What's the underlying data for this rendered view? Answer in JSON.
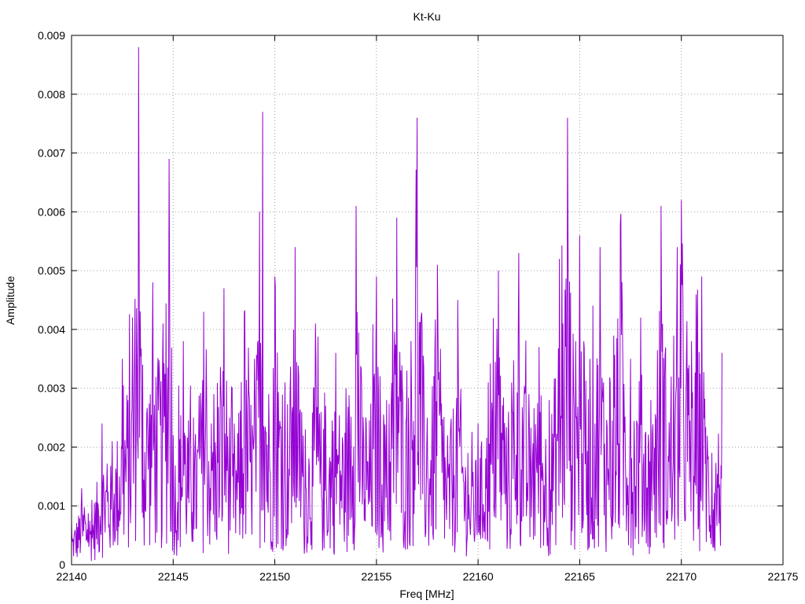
{
  "chart_data": {
    "type": "line",
    "title": "Kt-Ku",
    "xlabel": "Freq [MHz]",
    "ylabel": "Amplitude",
    "xlim": [
      22140,
      22175
    ],
    "ylim": [
      0,
      0.009
    ],
    "xticks": [
      "22140",
      "22145",
      "22150",
      "22155",
      "22160",
      "22165",
      "22170",
      "22175"
    ],
    "yticks": [
      "0",
      "0.001",
      "0.002",
      "0.003",
      "0.004",
      "0.005",
      "0.006",
      "0.007",
      "0.008",
      "0.009"
    ],
    "grid": true,
    "series": [
      {
        "color": "#9400d3",
        "x": [
          22140.0,
          22140.5,
          22141.0,
          22141.5,
          22142.0,
          22142.5,
          22143.0,
          22143.3,
          22143.5,
          22144.0,
          22144.5,
          22144.8,
          22145.0,
          22145.5,
          22146.0,
          22146.5,
          22147.0,
          22147.5,
          22148.0,
          22148.5,
          22149.0,
          22149.4,
          22149.7,
          22150.0,
          22150.5,
          22151.0,
          22151.5,
          22152.0,
          22152.5,
          22153.0,
          22153.5,
          22154.0,
          22154.5,
          22155.0,
          22155.5,
          22156.0,
          22156.5,
          22157.0,
          22157.5,
          22158.0,
          22158.5,
          22159.0,
          22159.5,
          22160.0,
          22160.5,
          22161.0,
          22161.5,
          22162.0,
          22162.5,
          22163.0,
          22163.5,
          22164.0,
          22164.4,
          22164.8,
          22165.0,
          22165.5,
          22166.0,
          22166.5,
          22167.0,
          22167.5,
          22168.0,
          22168.5,
          22169.0,
          22169.5,
          22170.0,
          22170.5,
          22171.0,
          22171.5,
          22172.0
        ],
        "y": [
          0.0007,
          0.0013,
          0.0011,
          0.0024,
          0.0021,
          0.0035,
          0.0042,
          0.0088,
          0.0034,
          0.0048,
          0.0041,
          0.0069,
          0.0022,
          0.0038,
          0.0025,
          0.0043,
          0.0029,
          0.0047,
          0.0024,
          0.0043,
          0.0035,
          0.0077,
          0.0029,
          0.0049,
          0.0031,
          0.0054,
          0.0023,
          0.0041,
          0.0027,
          0.0036,
          0.003,
          0.0061,
          0.0024,
          0.0049,
          0.0028,
          0.0059,
          0.0033,
          0.0076,
          0.0025,
          0.0051,
          0.0022,
          0.0045,
          0.0019,
          0.0024,
          0.0031,
          0.005,
          0.0026,
          0.0053,
          0.0029,
          0.0037,
          0.0028,
          0.0052,
          0.0076,
          0.0038,
          0.0056,
          0.0035,
          0.0054,
          0.0031,
          0.0058,
          0.0035,
          0.0042,
          0.0028,
          0.0061,
          0.0032,
          0.0062,
          0.0038,
          0.0049,
          0.0019,
          0.0036
        ]
      }
    ]
  }
}
